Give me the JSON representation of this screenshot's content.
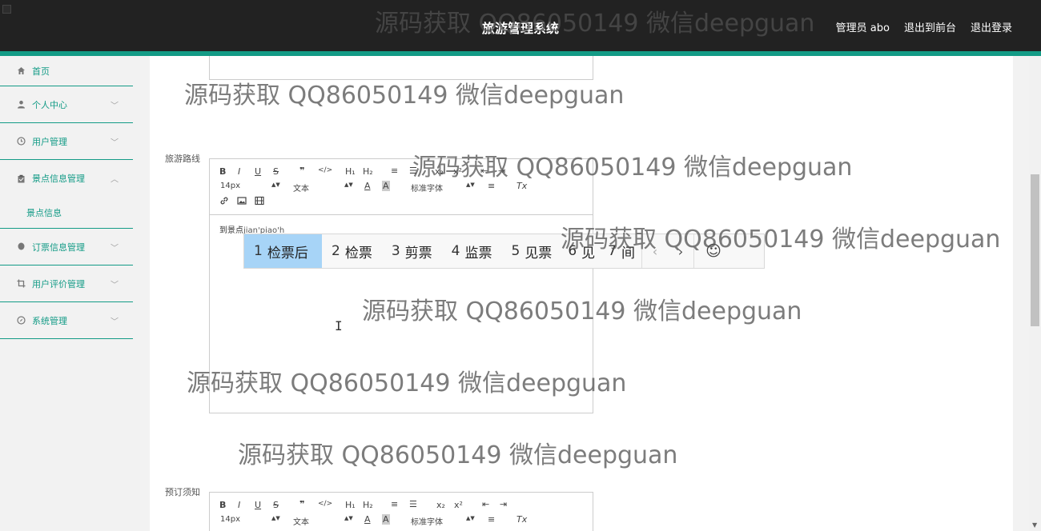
{
  "header": {
    "title": "旅游管理系统",
    "nav": [
      "管理员 abo",
      "退出到前台",
      "退出登录"
    ]
  },
  "sidebar": {
    "items": [
      {
        "label": "首页",
        "icon": "home-icon"
      },
      {
        "label": "个人中心",
        "icon": "user-icon"
      },
      {
        "label": "用户管理",
        "icon": "clock-icon"
      },
      {
        "label": "景点信息管理",
        "icon": "clipboard-icon",
        "expanded": true
      },
      {
        "label": "订票信息管理",
        "icon": "pin-icon"
      },
      {
        "label": "用户评价管理",
        "icon": "crop-icon"
      },
      {
        "label": "系统管理",
        "icon": "compass-icon"
      }
    ],
    "sub_items": [
      "景点信息"
    ]
  },
  "form": {
    "route_label": "旅游路线",
    "notice_label": "预订须知",
    "route_text": "到景点",
    "route_composing": "jian'piao'h"
  },
  "toolbar": {
    "bold": "B",
    "italic": "I",
    "underline": "U",
    "strike": "S",
    "quote": "❞",
    "code": "</>",
    "h1": "H₁",
    "h2": "H₂",
    "ordered_list": "≡",
    "bullet_list": "☰",
    "subscript": "x₂",
    "superscript": "x²",
    "outdent": "⇤",
    "indent": "⇥",
    "size": "14px",
    "format": "文本",
    "font": "标准字体",
    "color": "A",
    "bgcolor": "A",
    "align": "≡",
    "clean": "Tx",
    "link": "🔗",
    "image": "▣",
    "video": "▦"
  },
  "ime": {
    "candidates": [
      {
        "num": "1",
        "text": "检票后"
      },
      {
        "num": "2",
        "text": "检票"
      },
      {
        "num": "3",
        "text": "剪票"
      },
      {
        "num": "4",
        "text": "监票"
      },
      {
        "num": "5",
        "text": "见票"
      },
      {
        "num": "6",
        "text": "见"
      },
      {
        "num": "7",
        "text": "间"
      }
    ],
    "prev": "‹",
    "next": "›",
    "emoji": "☺"
  },
  "watermark": "源码获取 QQ86050149 微信deepguan",
  "colors": {
    "accent": "#139b86",
    "header": "#222222",
    "candidate_highlight": "#a7d4f7"
  }
}
